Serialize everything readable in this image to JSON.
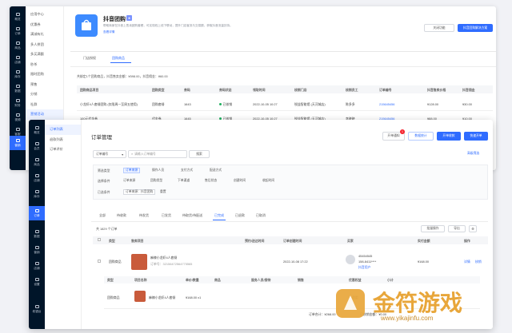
{
  "back": {
    "sidebar": {
      "items": [
        "概览",
        "订单",
        "商品",
        "店铺",
        "库存",
        "营销",
        "数据",
        "财务",
        "视频",
        "客服",
        "营销"
      ],
      "active_index": 5
    },
    "submenu": [
      "应用中心",
      "优惠券",
      "满减有礼",
      "多人拼团",
      "多买满额",
      "秒杀",
      "限时团购",
      "预售",
      "分销",
      "社群",
      "营销活动"
    ],
    "app": {
      "title": "抖音团购",
      "badge": "★",
      "desc": "帮助商家在抖音上售卖团购套餐，可实现线上线下联动，提升门店客流与交易额，获取抖音流量扶持。",
      "more_link": "查看详情",
      "btn_close": "关闭功能",
      "btn_solution": "抖音团购解决方案"
    },
    "tabs": [
      "门店授权",
      "团购商品"
    ],
    "active_tab": 1,
    "summary": "共绑定1个团购商品，抖音售卖金额：¥598.00，抖音佣金：¥60.00",
    "table": {
      "headers": [
        "团购商品项目",
        "团购类型",
        "券码",
        "券码状态",
        "领取时间",
        "核销门店",
        "核销员工",
        "订单编号",
        "抖音售卖价格",
        "抖音佣金"
      ],
      "rows": [
        [
          "小龙虾4人套餐团购 (仅限周一至周五使用)",
          "团购套餐",
          "1643",
          "已核销",
          "2022-10-05 10:27",
          "锐益智能馆 (天河城店)",
          "陈多多",
          "215645456",
          "¥128.00",
          "¥30.00"
        ],
        [
          "100元代金券",
          "代金券",
          "1645",
          "已核销",
          "2022-10-05 10:27",
          "锐益智能馆 (天河城店)",
          "李晓晓",
          "215645456",
          "¥88.00",
          "¥10.00"
        ]
      ]
    }
  },
  "front": {
    "sidebar": {
      "items": [
        "概览",
        "会员",
        "商品",
        "店铺",
        "库存",
        "订单",
        "数据",
        "营销",
        "店铺",
        "设置"
      ],
      "active_index": 5,
      "bottom": "收银台"
    },
    "submenu": [
      "订单列表",
      "退款列表",
      "订单评价"
    ],
    "title": "订单管理",
    "actions": {
      "notice": "开单通知",
      "notice_badge": "1",
      "stats": "数据统计",
      "new_order": "开单收款",
      "quick": "快速开单",
      "filter_toggle": "高级筛选"
    },
    "search": {
      "type_value": "订单编号",
      "placeholder": "请输入订单编号",
      "button": "搜索"
    },
    "filters": [
      {
        "label": "筛选类型",
        "options": [
          "订单来源",
          "操作人员",
          "支付方式",
          "配送方式"
        ]
      },
      {
        "label": "选择条件",
        "options": [
          "订单来源",
          "团购类型",
          "下单渠道",
          "售后状态",
          "创建时间",
          "收起时间"
        ]
      },
      {
        "label": "已选条件",
        "options": [
          "订单来源：抖音团购",
          "重置"
        ]
      }
    ],
    "status_tabs": [
      "全部",
      "待收款",
      "待发货",
      "已发货",
      "待取货/待配送",
      "已完成",
      "已退款",
      "已取消"
    ],
    "active_status": 5,
    "count_text": "共 1829 个订单",
    "batch_buttons": [
      "批量操作",
      "导出"
    ],
    "table_headers": [
      "",
      "类型",
      "售卖项目",
      "",
      "预约/送达时间",
      "订单创建时间",
      "买家",
      "实付金额",
      "操作"
    ],
    "order": {
      "type": "团购商品",
      "item_name": "麻辣小龙虾4人套餐",
      "item_no": "订单号：32156472564775565",
      "created": "2022-10-08 17:22",
      "buyer_id": "45454545",
      "buyer_name": "158-8411****",
      "buyer_tag": "抖音用户",
      "amount": "¥168.00",
      "actions": [
        "详情",
        "核销"
      ]
    },
    "detail_headers": [
      "类型",
      "项目名称",
      "单价/数量",
      "商品",
      "服务人员/接待",
      "销售",
      "优惠权益",
      "小计"
    ],
    "detail_row": {
      "type": "团购商品",
      "name": "麻辣小龙虾4人套餐",
      "price": "¥168.00 x1",
      "sub": "x1",
      "status": "不适用"
    },
    "footer": {
      "total": "订单合计：¥268.00",
      "paid": "已核销金额：¥0.00"
    }
  },
  "watermark": {
    "text": "金符游戏",
    "url": "www.yikajinfu.com"
  }
}
